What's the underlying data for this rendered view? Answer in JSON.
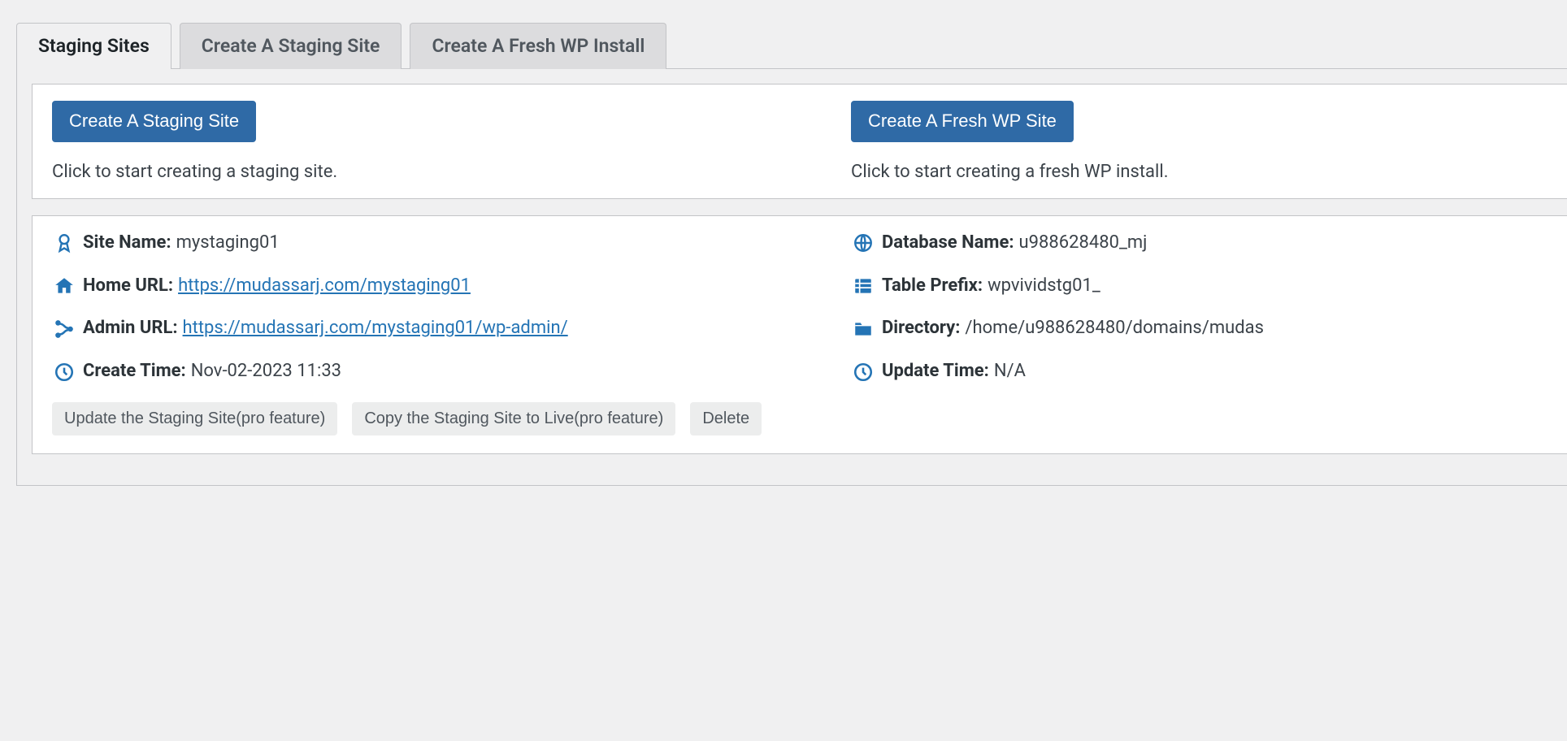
{
  "tabs": {
    "staging_sites": "Staging Sites",
    "create_staging": "Create A Staging Site",
    "create_fresh": "Create A Fresh WP Install"
  },
  "top_card": {
    "btn_create_staging": "Create A Staging Site",
    "desc_staging": "Click to start creating a staging site.",
    "btn_create_fresh": "Create A Fresh WP Site",
    "desc_fresh": "Click to start creating a fresh WP install."
  },
  "site": {
    "site_name_label": "Site Name:",
    "site_name_value": "mystaging01",
    "home_url_label": "Home URL:",
    "home_url_value": "https://mudassarj.com/mystaging01",
    "admin_url_label": "Admin URL:",
    "admin_url_value": "https://mudassarj.com/mystaging01/wp-admin/",
    "create_time_label": "Create Time:",
    "create_time_value": "Nov-02-2023 11:33",
    "db_name_label": "Database Name:",
    "db_name_value": "u988628480_mj",
    "table_prefix_label": "Table Prefix:",
    "table_prefix_value": "wpvividstg01_",
    "directory_label": "Directory:",
    "directory_value": "/home/u988628480/domains/mudas",
    "update_time_label": "Update Time:",
    "update_time_value": "N/A"
  },
  "actions": {
    "update": "Update the Staging Site(pro feature)",
    "copy": "Copy the Staging Site to Live(pro feature)",
    "delete": "Delete"
  }
}
